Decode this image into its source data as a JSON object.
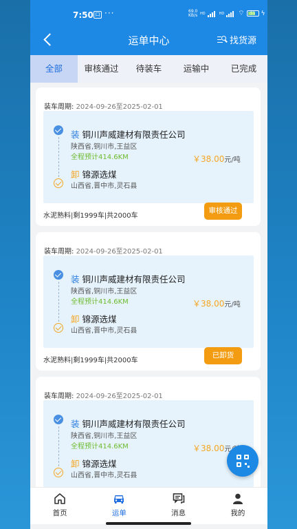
{
  "status_bar": {
    "time": "7:50",
    "notification_badge": "口",
    "more": "···",
    "network": "69.0 KB/s",
    "hd1": "HD",
    "hd2": "HD",
    "battery": "51"
  },
  "header": {
    "title": "运单中心",
    "find_source_label": "找货源"
  },
  "tabs": [
    {
      "label": "全部",
      "active": true
    },
    {
      "label": "审核通过",
      "active": false
    },
    {
      "label": "待装车",
      "active": false
    },
    {
      "label": "运输中",
      "active": false
    },
    {
      "label": "已完成",
      "active": false
    }
  ],
  "orders": [
    {
      "period_label": "装车周期:",
      "period_value": "2024-09-26至2025-02-01",
      "load_tag": "装",
      "load_company": "铜川声威建材有限责任公司",
      "load_address": "陕西省,铜川市,王益区",
      "distance": "全程预计414.6KM",
      "price": "￥38.00",
      "price_unit": "元/吨",
      "unload_tag": "卸",
      "unload_name": "锦源选煤",
      "unload_address": "山西省,晋中市,灵石县",
      "goods": "水泥熟料|剩1999车|共2000车",
      "status": "审核通过"
    },
    {
      "period_label": "装车周期:",
      "period_value": "2024-09-26至2025-02-01",
      "load_tag": "装",
      "load_company": "铜川声威建材有限责任公司",
      "load_address": "陕西省,铜川市,王益区",
      "distance": "全程预计414.6KM",
      "price": "￥38.00",
      "price_unit": "元/吨",
      "unload_tag": "卸",
      "unload_name": "锦源选煤",
      "unload_address": "山西省,晋中市,灵石县",
      "goods": "水泥熟料|剩1999车|共2000车",
      "status": "已卸货"
    },
    {
      "period_label": "装车周期:",
      "period_value": "2024-09-26至2025-02-01",
      "load_tag": "装",
      "load_company": "铜川声威建材有限责任公司",
      "load_address": "陕西省,铜川市,王益区",
      "distance": "全程预计414.6KM",
      "price": "￥38.00",
      "price_unit": "元/吨",
      "unload_tag": "卸",
      "unload_name": "锦源选煤",
      "unload_address": "山西省,晋中市,灵石县",
      "goods": "",
      "status": ""
    }
  ],
  "bottom_nav": [
    {
      "label": "首页",
      "icon": "home-icon",
      "active": false
    },
    {
      "label": "运单",
      "icon": "truck-icon",
      "active": true
    },
    {
      "label": "消息",
      "icon": "message-icon",
      "active": false
    },
    {
      "label": "我的",
      "icon": "profile-icon",
      "active": false
    }
  ],
  "colors": {
    "primary": "#1e88e5",
    "accent_orange": "#f39c12",
    "distance_green": "#6dbb2e",
    "tab_active_bg": "#c8d6f5"
  }
}
